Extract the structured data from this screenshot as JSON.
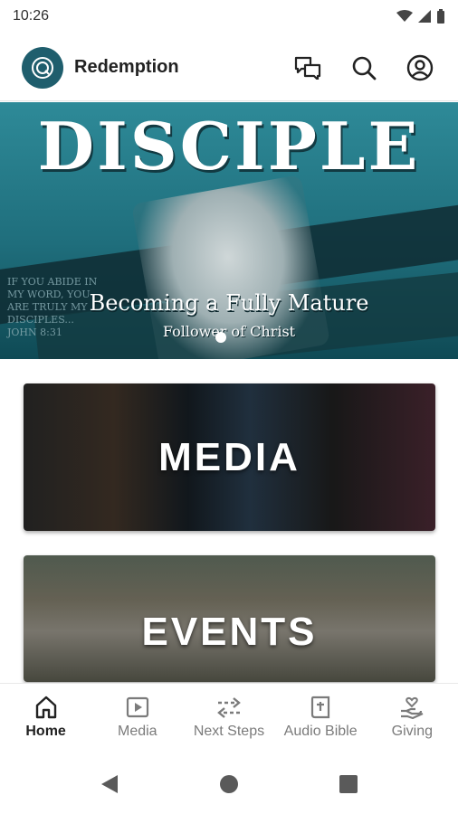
{
  "status_bar": {
    "time": "10:26"
  },
  "app_bar": {
    "title": "Redemption",
    "icons": [
      "chat-icon",
      "search-icon",
      "account-icon"
    ]
  },
  "hero": {
    "title": "DISCIPLE",
    "subtitle": "Becoming a Fully Mature",
    "subtitle2": "Follower of Christ",
    "verse": "If you abide in my word, you are truly my disciples... John 8:31"
  },
  "cards": [
    {
      "label": "MEDIA"
    },
    {
      "label": "EVENTS"
    }
  ],
  "bottom_nav": {
    "active": "Home",
    "items": [
      {
        "label": "Home",
        "icon": "home-icon"
      },
      {
        "label": "Media",
        "icon": "play-icon"
      },
      {
        "label": "Next Steps",
        "icon": "arrows-icon"
      },
      {
        "label": "Audio Bible",
        "icon": "bible-icon"
      },
      {
        "label": "Giving",
        "icon": "giving-icon"
      }
    ]
  },
  "colors": {
    "brand": "#1f5e6d",
    "hero_teal": "#2e8a98"
  }
}
